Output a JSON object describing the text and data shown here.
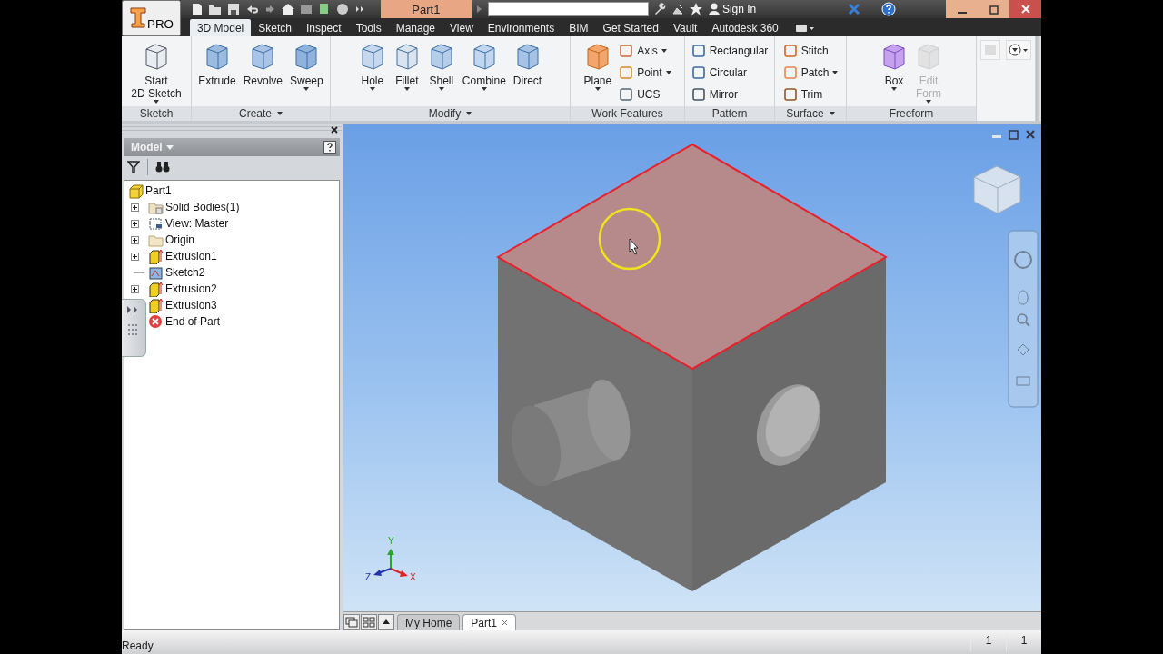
{
  "title_bar": {
    "app_badge": "PRO",
    "document_title": "Part1",
    "sign_in": "Sign In"
  },
  "ribbon_tabs": [
    {
      "label": "3D Model",
      "selected": true
    },
    {
      "label": "Sketch",
      "selected": false
    },
    {
      "label": "Inspect",
      "selected": false
    },
    {
      "label": "Tools",
      "selected": false
    },
    {
      "label": "Manage",
      "selected": false
    },
    {
      "label": "View",
      "selected": false
    },
    {
      "label": "Environments",
      "selected": false
    },
    {
      "label": "BIM",
      "selected": false
    },
    {
      "label": "Get Started",
      "selected": false
    },
    {
      "label": "Vault",
      "selected": false
    },
    {
      "label": "Autodesk 360",
      "selected": false
    }
  ],
  "ribbon_groups": [
    {
      "label": "Sketch",
      "has_menu": false,
      "tools": [
        {
          "label": "Start\n2D Sketch",
          "kind": "large",
          "dropdown": true,
          "disabled": false
        }
      ]
    },
    {
      "label": "Create",
      "has_menu": true,
      "tools": [
        {
          "label": "Extrude",
          "kind": "large",
          "dropdown": false,
          "disabled": false
        },
        {
          "label": "Revolve",
          "kind": "large",
          "dropdown": false,
          "disabled": false
        },
        {
          "label": "Sweep",
          "kind": "large",
          "dropdown": true,
          "disabled": false
        }
      ]
    },
    {
      "label": "Modify",
      "has_menu": true,
      "tools": [
        {
          "label": "Hole",
          "kind": "large",
          "dropdown": true,
          "disabled": false
        },
        {
          "label": "Fillet",
          "kind": "large",
          "dropdown": true,
          "disabled": false
        },
        {
          "label": "Shell",
          "kind": "large",
          "dropdown": true,
          "disabled": false
        },
        {
          "label": "Combine",
          "kind": "large",
          "dropdown": true,
          "disabled": false
        },
        {
          "label": "Direct",
          "kind": "large",
          "dropdown": false,
          "disabled": false
        }
      ]
    },
    {
      "label": "Work Features",
      "has_menu": false,
      "tools": [
        {
          "label": "Plane",
          "kind": "large",
          "dropdown": true,
          "disabled": false
        },
        {
          "label": "Axis",
          "kind": "small",
          "dropdown": true,
          "disabled": false
        },
        {
          "label": "Point",
          "kind": "small",
          "dropdown": true,
          "disabled": false
        },
        {
          "label": "UCS",
          "kind": "small",
          "dropdown": false,
          "disabled": false
        }
      ]
    },
    {
      "label": "Pattern",
      "has_menu": false,
      "tools": [
        {
          "label": "Rectangular",
          "kind": "small",
          "dropdown": false,
          "disabled": false
        },
        {
          "label": "Circular",
          "kind": "small",
          "dropdown": false,
          "disabled": false
        },
        {
          "label": "Mirror",
          "kind": "small",
          "dropdown": false,
          "disabled": false
        }
      ]
    },
    {
      "label": "Surface",
      "has_menu": true,
      "tools": [
        {
          "label": "Stitch",
          "kind": "small",
          "dropdown": false,
          "disabled": false
        },
        {
          "label": "Patch",
          "kind": "small",
          "dropdown": true,
          "disabled": false
        },
        {
          "label": "Trim",
          "kind": "small",
          "dropdown": false,
          "disabled": false
        }
      ]
    },
    {
      "label": "Freeform",
      "has_menu": false,
      "tools": [
        {
          "label": "Box",
          "kind": "large",
          "dropdown": true,
          "disabled": false
        },
        {
          "label": "Edit\nForm",
          "kind": "large",
          "dropdown": true,
          "disabled": true
        }
      ]
    }
  ],
  "browser": {
    "title": "Model",
    "tree": [
      {
        "label": "Part1",
        "kind": "part",
        "expandable": false,
        "children": [
          {
            "label": "Solid Bodies(1)",
            "kind": "bodies",
            "expandable": true
          },
          {
            "label": "View: Master",
            "kind": "view",
            "expandable": true
          },
          {
            "label": "Origin",
            "kind": "folder",
            "expandable": true
          },
          {
            "label": "Extrusion1",
            "kind": "extrusion",
            "expandable": true
          },
          {
            "label": "Sketch2",
            "kind": "sketch",
            "expandable": false
          },
          {
            "label": "Extrusion2",
            "kind": "extrusion",
            "expandable": true
          },
          {
            "label": "Extrusion3",
            "kind": "extrusion"
          },
          {
            "label": "End of Part",
            "kind": "end"
          }
        ]
      }
    ]
  },
  "viewport": {
    "top_face_selected": true,
    "axes": [
      {
        "label": "Y"
      },
      {
        "label": "X"
      },
      {
        "label": "Z"
      }
    ]
  },
  "document_tabs": [
    {
      "label": "My Home",
      "selected": false,
      "closable": false
    },
    {
      "label": "Part1",
      "selected": true,
      "closable": true
    }
  ],
  "status_bar": {
    "message": "Ready",
    "counters": [
      "1",
      "1"
    ]
  }
}
